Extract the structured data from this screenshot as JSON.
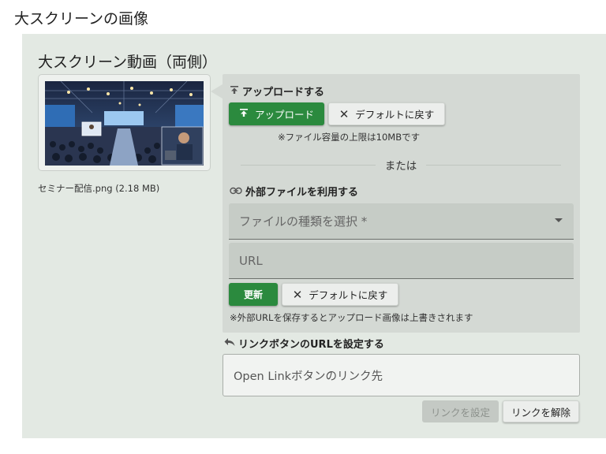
{
  "page": {
    "title": "大スクリーンの画像"
  },
  "section": {
    "title": "大スクリーン動画（両側）"
  },
  "preview": {
    "file_name": "セミナー配信.png (2.18 MB)",
    "image_icon": "seminar-hall-photo"
  },
  "upload": {
    "heading": "アップロードする",
    "heading_icon": "upload-icon",
    "upload_button": "アップロード",
    "reset_button": "デフォルトに戻す",
    "limit_note": "※ファイル容量の上限は10MBです"
  },
  "divider": {
    "text": "または"
  },
  "external": {
    "heading": "外部ファイルを利用する",
    "heading_icon": "link-icon",
    "type_select_placeholder": "ファイルの種類を選択 *",
    "url_placeholder": "URL",
    "update_button": "更新",
    "reset_button": "デフォルトに戻す",
    "overwrite_note": "※外部URLを保存するとアップロード画像は上書きされます"
  },
  "link": {
    "heading": "リンクボタンのURLを設定する",
    "heading_icon": "reply-arrow-icon",
    "input_placeholder": "Open Linkボタンのリンク先",
    "set_button": "リンクを設定",
    "clear_button": "リンクを解除"
  },
  "colors": {
    "primary_green": "#2b8a3e",
    "panel_bg": "#e3e9e3",
    "box_bg": "#d4d9d4"
  }
}
